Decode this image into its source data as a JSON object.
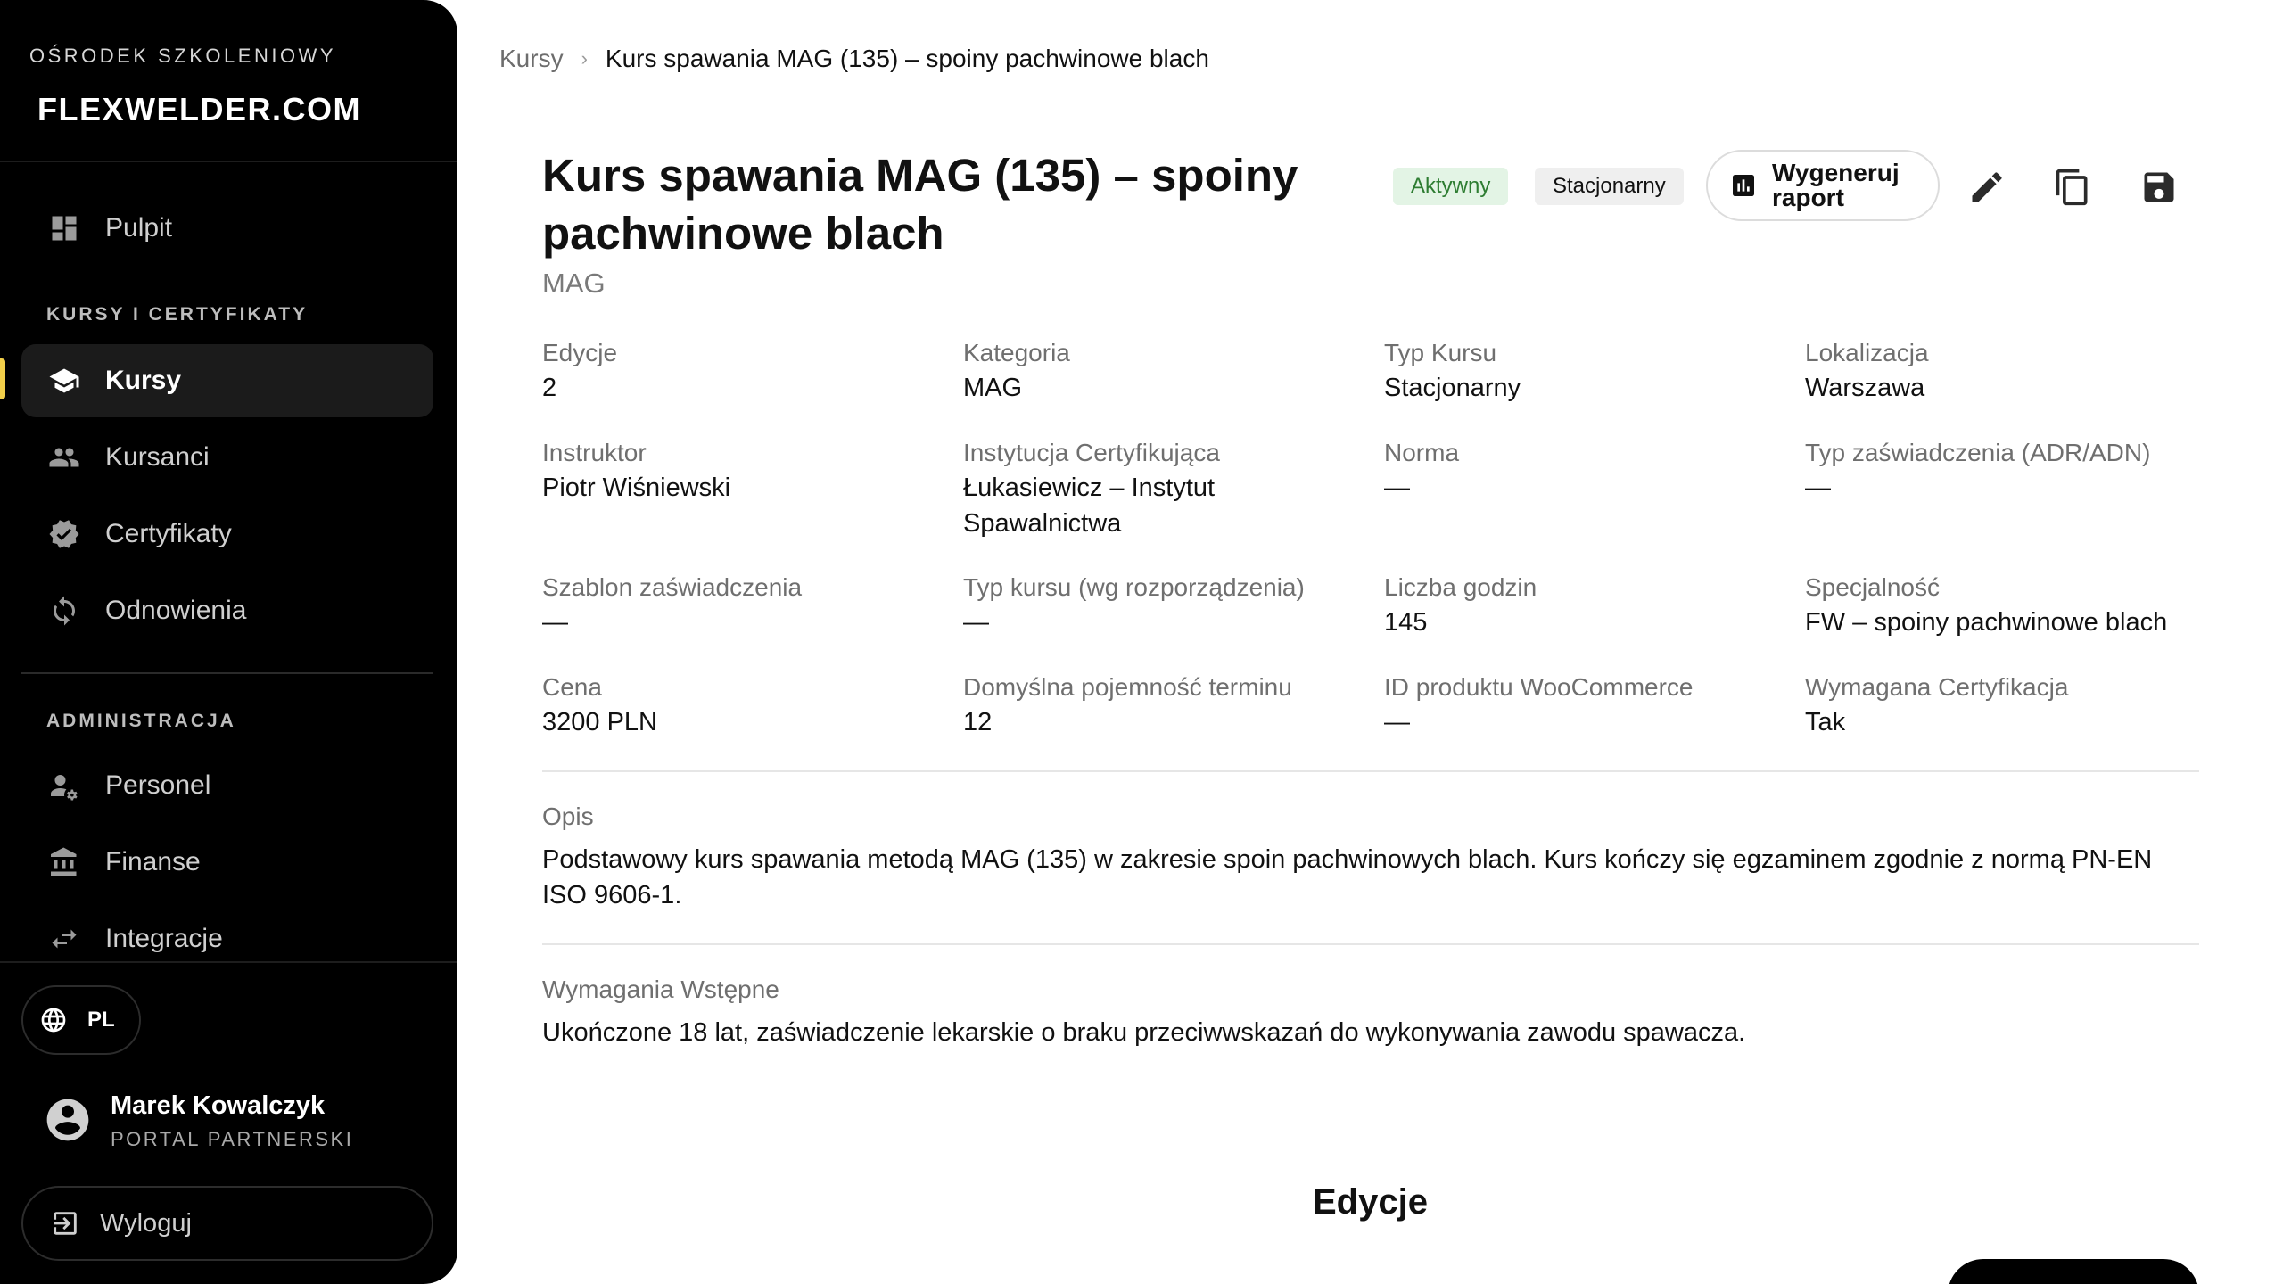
{
  "sidebar": {
    "brand_sub": "OŚRODEK SZKOLENIOWY",
    "brand_logo": "FLEXWELDER.COM",
    "items": [
      {
        "label": "Pulpit",
        "icon": "dashboard-icon"
      },
      {
        "label": "Kursy",
        "icon": "school-icon",
        "active": true
      },
      {
        "label": "Kursanci",
        "icon": "people-icon"
      },
      {
        "label": "Certyfikaty",
        "icon": "verified-icon"
      },
      {
        "label": "Odnowienia",
        "icon": "renew-icon"
      },
      {
        "label": "Personel",
        "icon": "staff-icon"
      },
      {
        "label": "Finanse",
        "icon": "bank-icon"
      },
      {
        "label": "Integracje",
        "icon": "sync-arrows-icon"
      }
    ],
    "section_courses": "KURSY I CERTYFIKATY",
    "section_admin": "ADMINISTRACJA",
    "language": "PL",
    "user": {
      "name": "Marek Kowalczyk",
      "role": "PORTAL PARTNERSKI"
    },
    "logout_label": "Wyloguj"
  },
  "breadcrumb": {
    "root": "Kursy",
    "current": "Kurs spawania MAG (135) – spoiny pachwinowe blach"
  },
  "course": {
    "title": "Kurs spawania MAG (135) – spoiny pachwinowe blach",
    "subtitle": "MAG",
    "status_badge": "Aktywny",
    "type_badge": "Stacjonarny",
    "report_button": "Wygeneruj raport",
    "colors": {
      "status_bg": "#e3f4e5",
      "status_text": "#2e7d32",
      "accent": "#f2cf4a"
    }
  },
  "fields": [
    {
      "label": "Edycje",
      "value": "2"
    },
    {
      "label": "Kategoria",
      "value": "MAG"
    },
    {
      "label": "Typ Kursu",
      "value": "Stacjonarny"
    },
    {
      "label": "Lokalizacja",
      "value": "Warszawa"
    },
    {
      "label": "Instruktor",
      "value": "Piotr Wiśniewski"
    },
    {
      "label": "Instytucja Certyfikująca",
      "value": "Łukasiewicz – Instytut Spawalnictwa"
    },
    {
      "label": "Norma",
      "value": "—"
    },
    {
      "label": "Typ zaświadczenia (ADR/ADN)",
      "value": "—"
    },
    {
      "label": "Szablon zaświadczenia",
      "value": "—"
    },
    {
      "label": "Typ kursu (wg rozporządzenia)",
      "value": "—"
    },
    {
      "label": "Liczba godzin",
      "value": "145"
    },
    {
      "label": "Specjalność",
      "value": "FW – spoiny pachwinowe blach"
    },
    {
      "label": "Cena",
      "value": "3200 PLN"
    },
    {
      "label": "Domyślna pojemność terminu",
      "value": "12"
    },
    {
      "label": "ID produktu WooCommerce",
      "value": "—"
    },
    {
      "label": "Wymagana Certyfikacja",
      "value": "Tak"
    }
  ],
  "description": {
    "label": "Opis",
    "text": "Podstawowy kurs spawania metodą MAG (135) w zakresie spoin pachwinowych blach. Kurs kończy się egzaminem zgodnie z normą PN-EN ISO 9606-1."
  },
  "prerequisites": {
    "label": "Wymagania Wstępne",
    "text": "Ukończone 18 lat, zaświadczenie lekarskie o braku przeciwwskazań do wykonywania zawodu spawacza."
  },
  "editions_heading": "Edycje"
}
